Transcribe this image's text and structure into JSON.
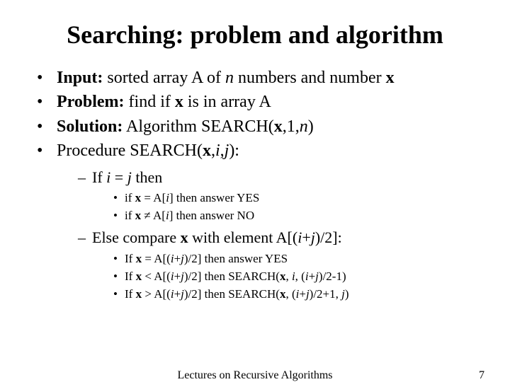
{
  "title": "Searching: problem and algorithm",
  "bullets": {
    "b1": {
      "label": "Input:",
      "rest_a": " sorted array A of ",
      "n": "n",
      "rest_b": " numbers and number ",
      "x": "x"
    },
    "b2": {
      "label": "Problem:",
      "rest_a": " find if ",
      "x": "x",
      "rest_b": " is in array A"
    },
    "b3": {
      "label": "Solution:",
      "rest_a": " Algorithm SEARCH(",
      "x": "x",
      "comma1": ",",
      "one": "1",
      "comma2": ",",
      "n": "n",
      "close": ")"
    },
    "b4": {
      "rest_a": "Procedure SEARCH(",
      "x": "x",
      "c1": ",",
      "i": "i",
      "c2": ",",
      "j": "j",
      "close": "):"
    }
  },
  "sub": {
    "s1": {
      "a": "If  ",
      "i": "i",
      "eq": " = ",
      "j": "j",
      "then": " then"
    },
    "s1_1": {
      "a": "if  ",
      "x": "x",
      "eq": " = A[",
      "i": "i",
      "close": "] then answer YES"
    },
    "s1_2": {
      "a": "if  ",
      "x": "x",
      "neq": " ≠ A[",
      "i": "i",
      "close": "] then answer NO"
    },
    "s2": {
      "a": "Else compare ",
      "x": "x",
      "b": " with element A[(",
      "i": "i",
      "plus": "+",
      "j": "j",
      "close": ")/2]:"
    },
    "s2_1": {
      "a": "If ",
      "x": "x",
      "b": " = A[(",
      "i": "i",
      "plus": "+",
      "j": "j",
      "close": ")/2] then answer YES"
    },
    "s2_2": {
      "a": "If ",
      "x": "x",
      "b": " < A[(",
      "i": "i",
      "plus": "+",
      "j": "j",
      "mid": ")/2] then SEARCH(",
      "x2": "x",
      "c1": ", ",
      "i2": "i",
      "c2": ", (",
      "i3": "i",
      "plus2": "+",
      "j2": "j",
      "close": ")/2-1)"
    },
    "s2_3": {
      "a": "If ",
      "x": "x",
      "b": " > A[(",
      "i": "i",
      "plus": "+",
      "j": "j",
      "mid": ")/2] then SEARCH(",
      "x2": "x",
      "c1": ", (",
      "i2": "i",
      "plus2": "+",
      "j2": "j",
      "c2": ")/2+1, ",
      "j3": "j",
      "close": ")"
    }
  },
  "footer": {
    "center": "Lectures on Recursive Algorithms",
    "page": "7"
  }
}
